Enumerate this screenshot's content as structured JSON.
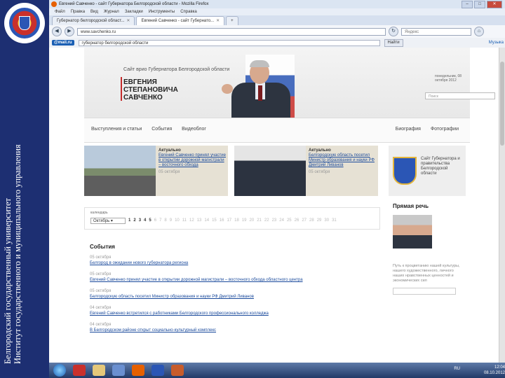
{
  "sidebar": {
    "text_line1": "Белгородский государственный университет",
    "text_line2": "Институт государственного и муниципального управления"
  },
  "browser": {
    "title": "Евгений Савченко - сайт Губернатора Белгородской области - Mozilla Firefox",
    "menu": [
      "Файл",
      "Правка",
      "Вид",
      "Журнал",
      "Закладки",
      "Инструменты",
      "Справка"
    ],
    "tabs": [
      "Губернатор белгородской област...",
      "Евгений Савченко - сайт Губернато..."
    ],
    "url": "www.savchenko.ru",
    "search_placeholder": "Яндекс"
  },
  "mailbar": {
    "brand": "@mail.ru",
    "query": "губернатор белгородской области",
    "search_btn": "Найти",
    "right": "Музыка"
  },
  "site": {
    "title_small": "Сайт врио Губернатора Белгородской области",
    "title_big": "ЕВГЕНИЯ СТЕПАНОВИЧА САВЧЕНКО",
    "date": "понедельник, 08 октября 2012",
    "search_placeholder": "Поиск",
    "nav_left": [
      "Выступления и статьи",
      "События",
      "Видеоблог"
    ],
    "nav_right": [
      "Биография",
      "Фотографии"
    ],
    "card1": {
      "label": "Актуально",
      "text": "Евгений Савченко принял участие в открытии дорожной магистрали – восточного обхода",
      "date": "05 октября"
    },
    "card2": {
      "label": "Актуально",
      "text": "Белгородскую область посетил Министр образования и науки РФ Дмитрий Ливанов",
      "date": "05 октября"
    },
    "gov": "Сайт Губернатора и правительства Белгородской области",
    "calendar_caption": "календарь",
    "calendar_month": "Октябрь",
    "days_active": [
      "1",
      "2",
      "3",
      "4",
      "5"
    ],
    "days_rest": [
      "6",
      "7",
      "8",
      "9",
      "10",
      "11",
      "12",
      "13",
      "14",
      "15",
      "16",
      "17",
      "18",
      "19",
      "20",
      "21",
      "22",
      "23",
      "24",
      "25",
      "26",
      "27",
      "28",
      "29",
      "30",
      "31"
    ],
    "events_title": "События",
    "events": [
      {
        "date": "05 октября",
        "text": "Белгород в ожидании нового губернатора региона"
      },
      {
        "date": "05 октября",
        "text": "Евгений Савченко принял участие в открытии дорожной магистрали – восточного обхода областного центра"
      },
      {
        "date": "05 октября",
        "text": "Белгородскую область посетил Министр образования и науки РФ Дмитрий Ливанов"
      },
      {
        "date": "04 октября",
        "text": "Евгений Савченко встретился с работниками Белгородского профессионального колледжа"
      },
      {
        "date": "04 октября",
        "text": "В Белгородском районе открыт социально-культурный комплекс"
      }
    ],
    "speech_title": "Прямая речь",
    "speech_quote": "Путь к процветанию нашей культуры, нашего художественного, личного наших нравственных ценностей и экономических сил"
  },
  "taskbar": {
    "lang": "RU",
    "time": "12:04",
    "date": "08.10.2012"
  }
}
